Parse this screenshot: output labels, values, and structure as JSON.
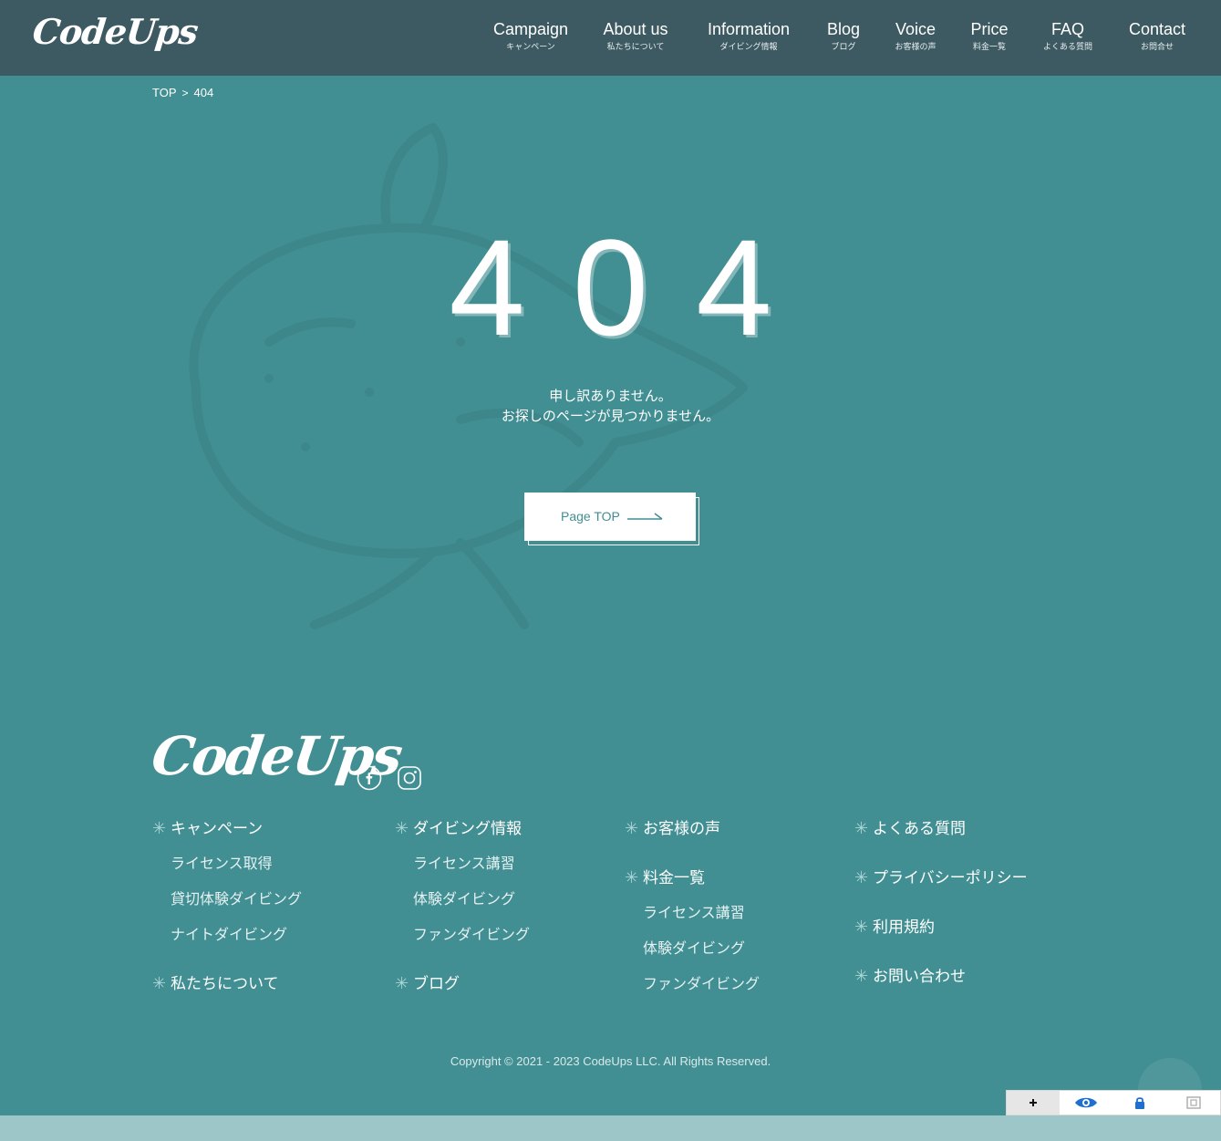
{
  "header": {
    "logo": "CodeUps",
    "nav": [
      {
        "en": "Campaign",
        "ja": "キャンペーン"
      },
      {
        "en": "About us",
        "ja": "私たちについて"
      },
      {
        "en": "Information",
        "ja": "ダイビング情報"
      },
      {
        "en": "Blog",
        "ja": "ブログ"
      },
      {
        "en": "Voice",
        "ja": "お客様の声"
      },
      {
        "en": "Price",
        "ja": "料金一覧"
      },
      {
        "en": "FAQ",
        "ja": "よくある質問"
      },
      {
        "en": "Contact",
        "ja": "お問合せ"
      }
    ]
  },
  "breadcrumb": {
    "home": "TOP",
    "separator": ">",
    "current": "404"
  },
  "error": {
    "code": "404",
    "line1": "申し訳ありません。",
    "line2": "お探しのページが見つかりません。",
    "button": "Page TOP"
  },
  "footer": {
    "logo": "CodeUps",
    "social": [
      "facebook-icon",
      "instagram-icon"
    ],
    "col1": {
      "campaign": "キャンペーン",
      "license": "ライセンス取得",
      "charter": "貸切体験ダイビング",
      "night": "ナイトダイビング",
      "about": "私たちについて"
    },
    "col2": {
      "info": "ダイビング情報",
      "course": "ライセンス講習",
      "trial": "体験ダイビング",
      "fun": "ファンダイビング",
      "blog": "ブログ"
    },
    "col3": {
      "voice": "お客様の声",
      "price": "料金一覧",
      "course": "ライセンス講習",
      "trial": "体験ダイビング",
      "fun": "ファンダイビング"
    },
    "col4": {
      "faq": "よくある質問",
      "privacy": "プライバシーポリシー",
      "terms": "利用規約",
      "contact": "お問い合わせ"
    },
    "copyright": "Copyright © 2021 - 2023 CodeUps LLC. All Rights Reserved."
  },
  "colors": {
    "background": "#418f92",
    "header": "#3d5a62",
    "text": "#ffffff"
  }
}
